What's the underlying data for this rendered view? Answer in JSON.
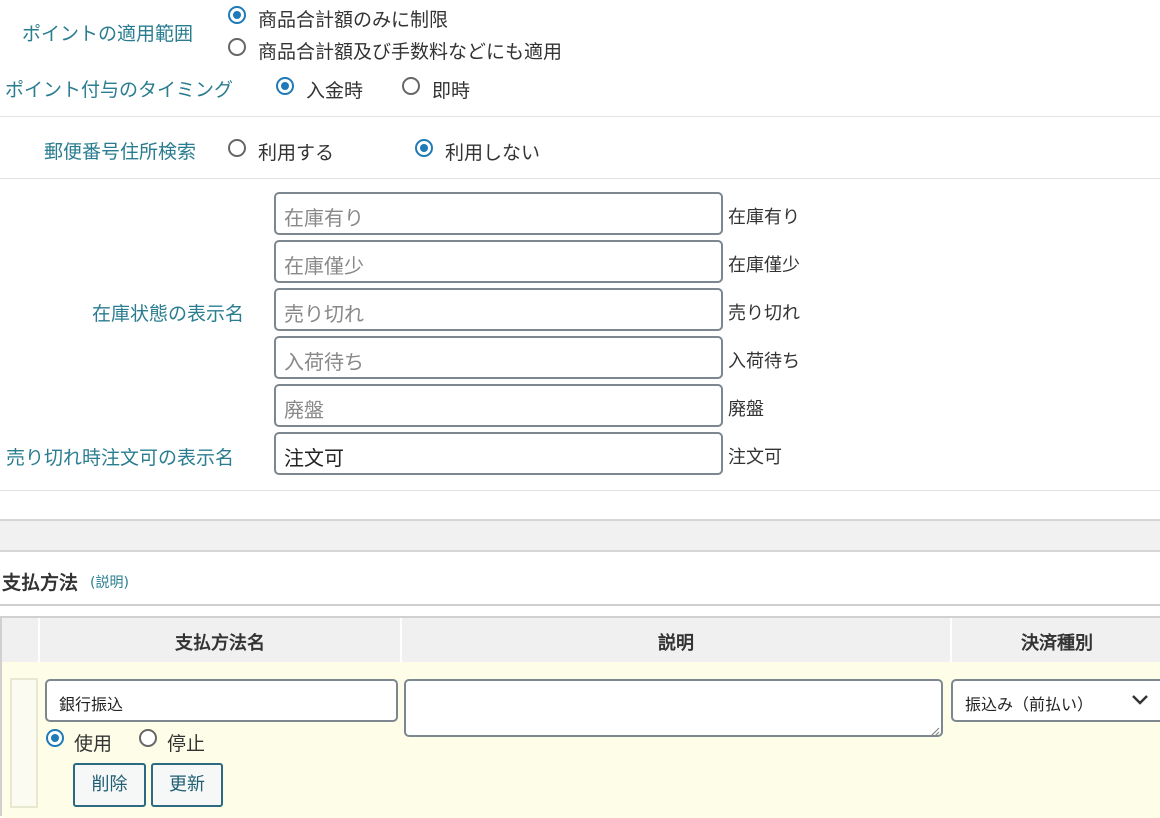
{
  "points": {
    "scope_label": "ポイントの適用範囲",
    "scope_option1": "商品合計額のみに制限",
    "scope_option2": "商品合計額及び手数料などにも適用",
    "timing_label": "ポイント付与のタイミング",
    "timing_option1": "入金時",
    "timing_option2": "即時"
  },
  "postal": {
    "label": "郵便番号住所検索",
    "option1": "利用する",
    "option2": "利用しない"
  },
  "stock": {
    "label": "在庫状態の表示名",
    "fields": [
      {
        "placeholder": "在庫有り",
        "side": "在庫有り"
      },
      {
        "placeholder": "在庫僅少",
        "side": "在庫僅少"
      },
      {
        "placeholder": "売り切れ",
        "side": "売り切れ"
      },
      {
        "placeholder": "入荷待ち",
        "side": "入荷待ち"
      },
      {
        "placeholder": "廃盤",
        "side": "廃盤"
      }
    ],
    "soldout_label": "売り切れ時注文可の表示名",
    "soldout_value": "注文可",
    "soldout_side": "注文可"
  },
  "payment": {
    "title": "支払方法",
    "help": "(説明)",
    "columns": [
      "支払方法名",
      "説明",
      "決済種別"
    ],
    "row": {
      "name": "銀行振込",
      "description": "",
      "use_label": "使用",
      "stop_label": "停止",
      "type_selected": "振込み（前払い）",
      "delete_label": "削除",
      "update_label": "更新"
    }
  },
  "colors": {
    "label_teal": "#2a7d90",
    "radio_blue": "#1e7ab8",
    "row_yellow": "#fefee8"
  }
}
